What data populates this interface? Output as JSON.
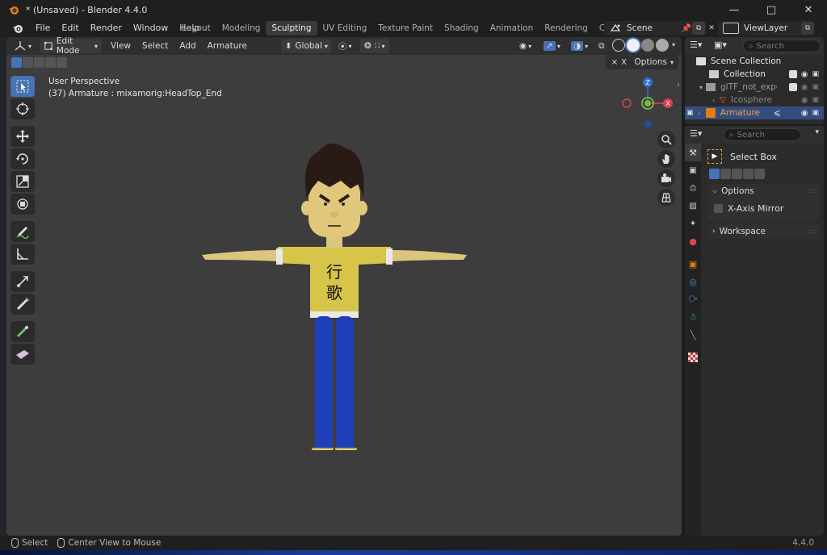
{
  "window": {
    "title": "* (Unsaved) - Blender 4.4.0",
    "controls": [
      "minimize-icon",
      "maximize-icon",
      "close-icon"
    ]
  },
  "menu": [
    "File",
    "Edit",
    "Render",
    "Window",
    "Help"
  ],
  "workspaces": [
    "Layout",
    "Modeling",
    "Sculpting",
    "UV Editing",
    "Texture Paint",
    "Shading",
    "Animation",
    "Rendering",
    "Compositing"
  ],
  "active_workspace": "Sculpting",
  "scene": "Scene",
  "view_layer": "ViewLayer",
  "viewport": {
    "mode": "Edit Mode",
    "menus": [
      "View",
      "Select",
      "Add",
      "Armature"
    ],
    "transform_orientation": "Global",
    "options_label": "Options",
    "x_label": "X",
    "info_line1": "User Perspective",
    "info_line2": "(37) Armature : mixamorig:HeadTop_End",
    "gizmo": {
      "z": "Z",
      "x": "X"
    },
    "shirt_text": [
      "行",
      "歌"
    ],
    "colors": {
      "shirt": "#d7c54a",
      "pants": "#1f3fb8",
      "skin": "#e0c77a",
      "hair": "#2a1a16",
      "bg": "#3d3d3d"
    }
  },
  "outliner": {
    "search_placeholder": "Search",
    "rows": [
      {
        "label": "Scene Collection"
      },
      {
        "label": "Collection"
      },
      {
        "label": "glTF_not_exported"
      },
      {
        "label": "Icosphere"
      },
      {
        "label": "Armature"
      }
    ]
  },
  "properties": {
    "search_placeholder": "Search",
    "tool_name": "Select Box",
    "options_label": "Options",
    "x_axis_mirror": "X-Axis Mirror",
    "workspace_label": "Workspace"
  },
  "status": {
    "select": "Select",
    "center": "Center View to Mouse",
    "version": "4.4.0"
  }
}
